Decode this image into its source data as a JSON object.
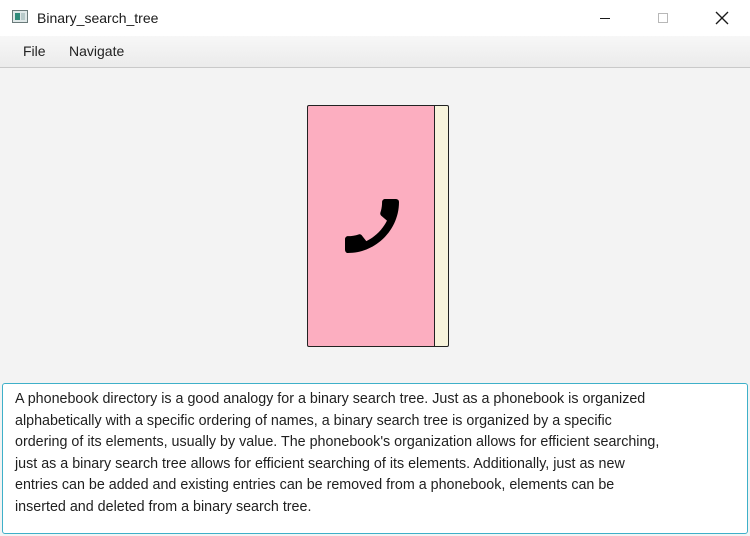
{
  "window": {
    "title": "Binary_search_tree"
  },
  "icons": {
    "app": "app-window-icon",
    "minimize": "minimize-icon",
    "maximize": "maximize-icon",
    "close": "close-icon",
    "phone": "phone-handset-icon"
  },
  "menu": {
    "items": [
      "File",
      "Navigate"
    ]
  },
  "illustration": {
    "subject": "phonebook",
    "cover_color": "#fcaec0",
    "pages_color": "#f8f4dc"
  },
  "description": {
    "lines": [
      "A phonebook directory is a good analogy for a binary search tree. Just as a phonebook is organized",
      "alphabetically with a specific ordering of names, a binary search tree is organized by a specific",
      "ordering of its elements, usually by value. The phonebook's organization allows for efficient searching,",
      "just as a binary search tree allows for efficient searching of its elements. Additionally, just as new",
      "entries can be added and existing entries can be removed from a phonebook, elements can be",
      "inserted and deleted from a binary search tree."
    ]
  },
  "colors": {
    "textarea_focus_border": "#3eb0c9"
  }
}
